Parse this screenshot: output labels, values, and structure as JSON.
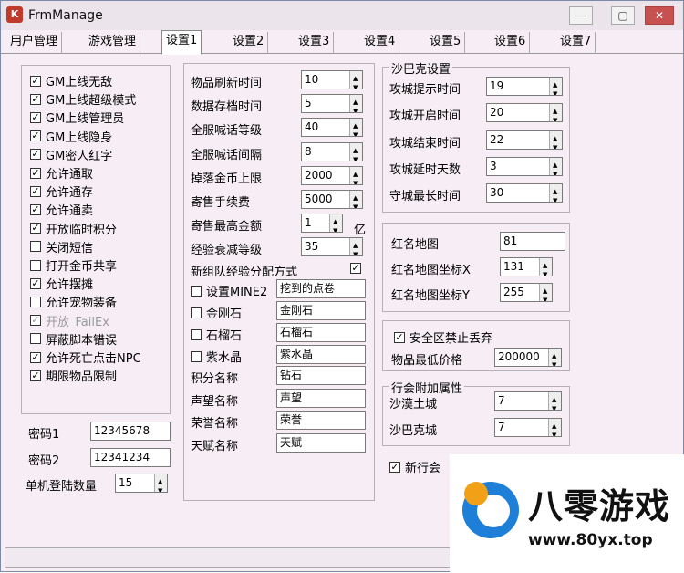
{
  "window": {
    "title": "FrmManage",
    "minimize": "—",
    "maximize": "▢",
    "close": "✕"
  },
  "tabs": [
    "用户管理",
    "游戏管理",
    "设置1",
    "设置2",
    "设置3",
    "设置4",
    "设置5",
    "设置6",
    "设置7"
  ],
  "left": {
    "checks": [
      {
        "label": "GM上线无敌",
        "checked": true
      },
      {
        "label": "GM上线超级模式",
        "checked": true
      },
      {
        "label": "GM上线管理员",
        "checked": true
      },
      {
        "label": "GM上线隐身",
        "checked": true
      },
      {
        "label": "GM密人红字",
        "checked": true
      },
      {
        "label": "允许通取",
        "checked": true
      },
      {
        "label": "允许通存",
        "checked": true
      },
      {
        "label": "允许通卖",
        "checked": true
      },
      {
        "label": "开放临时积分",
        "checked": true
      },
      {
        "label": "关闭短信",
        "checked": false
      },
      {
        "label": "打开金币共享",
        "checked": false
      },
      {
        "label": "允许摆摊",
        "checked": true
      },
      {
        "label": "允许宠物装备",
        "checked": false
      },
      {
        "label": "开放_FailEx",
        "checked": true,
        "disabled": true
      },
      {
        "label": "屏蔽脚本错误",
        "checked": false
      },
      {
        "label": "允许死亡点击NPC",
        "checked": true
      },
      {
        "label": "期限物品限制",
        "checked": true
      }
    ],
    "password1_label": "密码1",
    "password1": "12345678",
    "password2_label": "密码2",
    "password2": "12341234",
    "login_count_label": "单机登陆数量",
    "login_count": "15"
  },
  "middle": {
    "fields": [
      {
        "label": "物品刷新时间",
        "value": "10"
      },
      {
        "label": "数据存档时间",
        "value": "5"
      },
      {
        "label": "全服喊话等级",
        "value": "40"
      },
      {
        "label": "全服喊话间隔",
        "value": "8"
      },
      {
        "label": "掉落金币上限",
        "value": "2000"
      },
      {
        "label": "寄售手续费",
        "value": "5000"
      },
      {
        "label": "寄售最高金额",
        "value": "1"
      },
      {
        "label": "经验衰减等级",
        "value": "35"
      }
    ],
    "yi_unit": "亿",
    "team_exp_label": "新组队经验分配方式",
    "team_exp_checked": true,
    "checks": [
      {
        "label": "设置MINE2",
        "value": "挖到的点卷"
      },
      {
        "label": "金刚石",
        "value": "金刚石"
      },
      {
        "label": "石榴石",
        "value": "石榴石"
      },
      {
        "label": "紫水晶",
        "value": "紫水晶"
      }
    ],
    "names": [
      {
        "label": "积分名称",
        "value": "钻石"
      },
      {
        "label": "声望名称",
        "value": "声望"
      },
      {
        "label": "荣誉名称",
        "value": "荣誉"
      },
      {
        "label": "天赋名称",
        "value": "天赋"
      }
    ]
  },
  "sbk": {
    "title": "沙巴克设置",
    "fields": [
      {
        "label": "攻城提示时间",
        "value": "19"
      },
      {
        "label": "攻城开启时间",
        "value": "20"
      },
      {
        "label": "攻城结束时间",
        "value": "22"
      },
      {
        "label": "攻城延时天数",
        "value": "3"
      },
      {
        "label": "守城最长时间",
        "value": "30"
      }
    ]
  },
  "redname": {
    "fields": [
      {
        "label": "红名地图",
        "value": "81"
      },
      {
        "label": "红名地图坐标X",
        "value": "131"
      },
      {
        "label": "红名地图坐标Y",
        "value": "255"
      }
    ]
  },
  "safe": {
    "label": "安全区禁止丢弃",
    "checked": true,
    "price_label": "物品最低价格",
    "price": "200000"
  },
  "guild": {
    "title": "行会附加属性",
    "fields": [
      {
        "label": "沙漠土城",
        "value": "7"
      },
      {
        "label": "沙巴克城",
        "value": "7"
      }
    ],
    "new_guild_label": "新行会"
  },
  "watermark": {
    "brand": "八零游戏",
    "url": "www.80yx.top"
  }
}
